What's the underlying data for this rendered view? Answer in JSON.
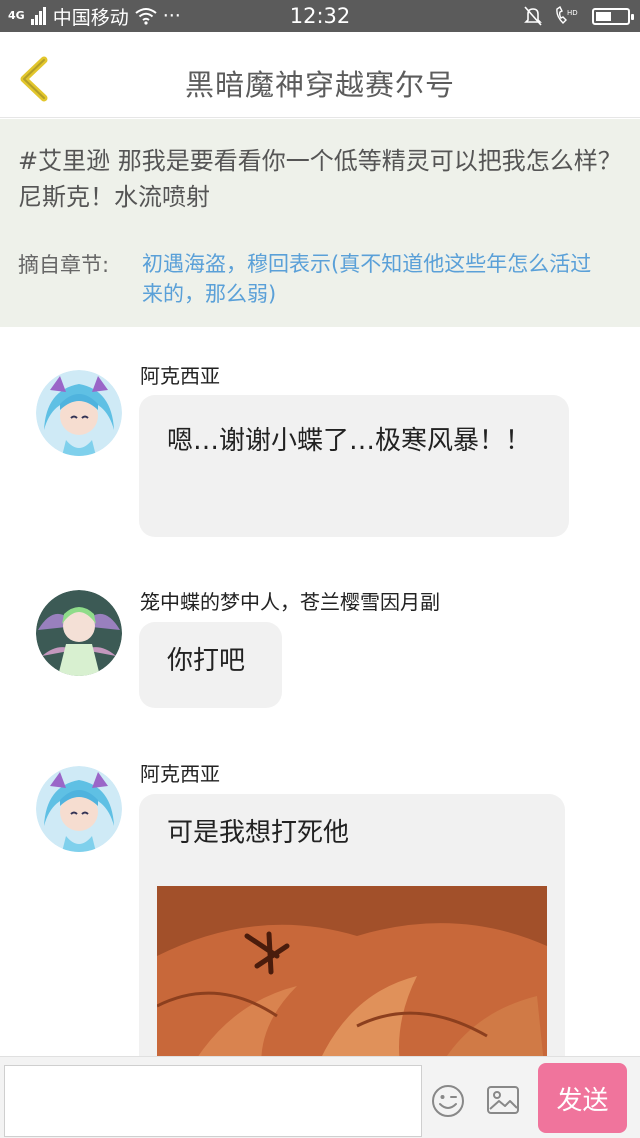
{
  "status_bar": {
    "signal_label": "4G",
    "carrier": "中国移动",
    "more": "···",
    "time": "12:32",
    "battery_level": 0.5
  },
  "header": {
    "title": "黑暗魔神穿越赛尔号"
  },
  "quote": {
    "text": "#艾里逊 那我是要看看你一个低等精灵可以把我怎么样？尼斯克！水流喷射",
    "chapter_label": "摘自章节:",
    "chapter_title": "初遇海盗，穆回表示(真不知道他这些年怎么活过来的，那么弱)"
  },
  "messages": [
    {
      "sender": "阿克西亚",
      "text": "嗯…谢谢小蝶了…极寒风暴！！"
    },
    {
      "sender": "笼中蝶的梦中人，苍兰樱雪因月副",
      "text": "你打吧"
    },
    {
      "sender": "阿克西亚",
      "text": "可是我想打死他"
    }
  ],
  "composer": {
    "input_value": "",
    "send_label": "发送"
  },
  "colors": {
    "status_bar": "#5b5b5b",
    "back_arrow": "#e2c62c",
    "quote_bg": "#eef1ea",
    "link": "#5aa0d8",
    "send_button": "#f0749c"
  },
  "icons": [
    "signal-icon",
    "wifi-icon",
    "mute-bell-icon",
    "call-hd-icon",
    "battery-icon",
    "back-arrow-icon",
    "emoji-icon",
    "image-icon"
  ]
}
